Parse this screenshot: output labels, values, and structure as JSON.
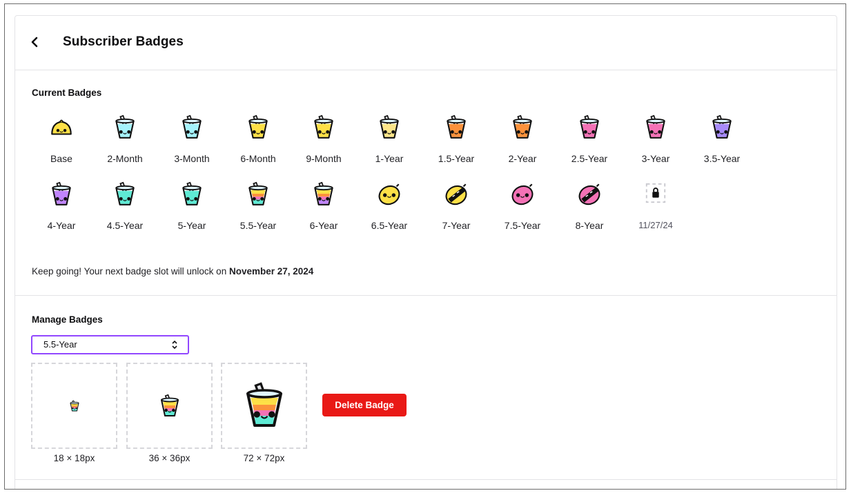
{
  "header": {
    "title": "Subscriber Badges",
    "back_icon": "chevron-left-icon"
  },
  "current": {
    "title": "Current Badges",
    "badges": [
      {
        "label": "Base",
        "style": "lemon-small",
        "color": "#fde047"
      },
      {
        "label": "2-Month",
        "style": "cup",
        "color": "#a5f3fc"
      },
      {
        "label": "3-Month",
        "style": "cup",
        "color": "#a5f3fc"
      },
      {
        "label": "6-Month",
        "style": "cup",
        "color": "#fde047"
      },
      {
        "label": "9-Month",
        "style": "cup",
        "color": "#fde047"
      },
      {
        "label": "1-Year",
        "style": "cup",
        "color": "#fde68a"
      },
      {
        "label": "1.5-Year",
        "style": "cup",
        "color": "#fb923c"
      },
      {
        "label": "2-Year",
        "style": "cup",
        "color": "#fb923c"
      },
      {
        "label": "2.5-Year",
        "style": "cup",
        "color": "#f472b6"
      },
      {
        "label": "3-Year",
        "style": "cup",
        "color": "#f472b6"
      },
      {
        "label": "3.5-Year",
        "style": "cup",
        "color": "#a78bfa"
      },
      {
        "label": "4-Year",
        "style": "cup",
        "color": "#c084fc"
      },
      {
        "label": "4.5-Year",
        "style": "cup",
        "color": "#5eead4"
      },
      {
        "label": "5-Year",
        "style": "cup",
        "color": "#5eead4"
      },
      {
        "label": "5.5-Year",
        "style": "rainbow",
        "color": "#5eead4"
      },
      {
        "label": "6-Year",
        "style": "rainbow",
        "color": "#c084fc"
      },
      {
        "label": "6.5-Year",
        "style": "lemon",
        "color": "#fde047"
      },
      {
        "label": "7-Year",
        "style": "lemon-shades",
        "color": "#fde047"
      },
      {
        "label": "7.5-Year",
        "style": "lemon",
        "color": "#f472b6"
      },
      {
        "label": "8-Year",
        "style": "lemon-shades",
        "color": "#f472b6"
      },
      {
        "label": "11/27/24",
        "style": "locked",
        "color": "#c9c9cf"
      }
    ],
    "note_prefix": "Keep going! Your next badge slot will unlock on ",
    "note_date": "November 27, 2024"
  },
  "manage": {
    "title": "Manage Badges",
    "select_value": "5.5-Year",
    "chevron": "⌃⌄",
    "previews": [
      {
        "label": "18 × 18px"
      },
      {
        "label": "36 × 36px"
      },
      {
        "label": "72 × 72px"
      }
    ],
    "delete_label": "Delete Badge"
  },
  "colors": {
    "accent": "#9147ff",
    "danger": "#e91916",
    "border": "#e3e3e6"
  }
}
